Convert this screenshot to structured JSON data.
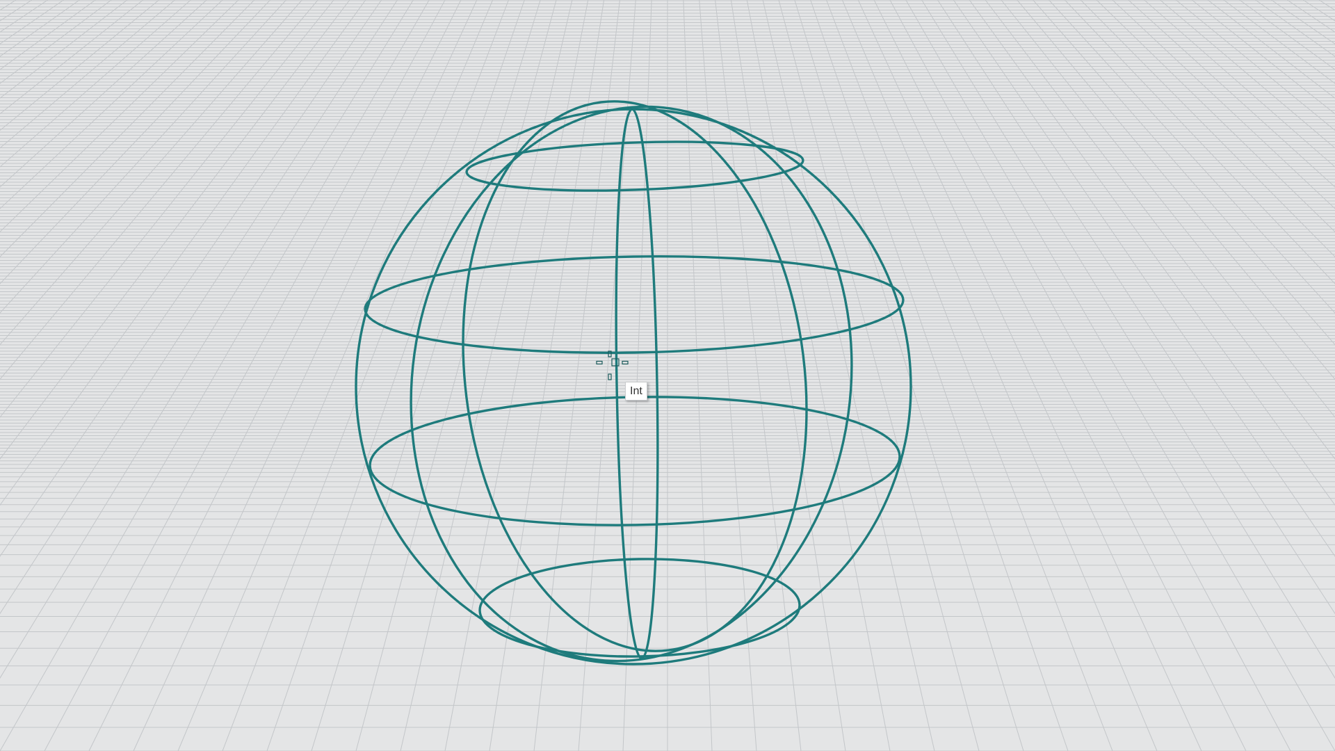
{
  "viewport": {
    "background_color": "#e4e5e6",
    "grid_color": "#c3c6c9",
    "object_color": "#1e7b7c",
    "object_type": "sphere-wireframe"
  },
  "osnap": {
    "label": "Int",
    "cursor_icon": "crosshair-icon"
  }
}
